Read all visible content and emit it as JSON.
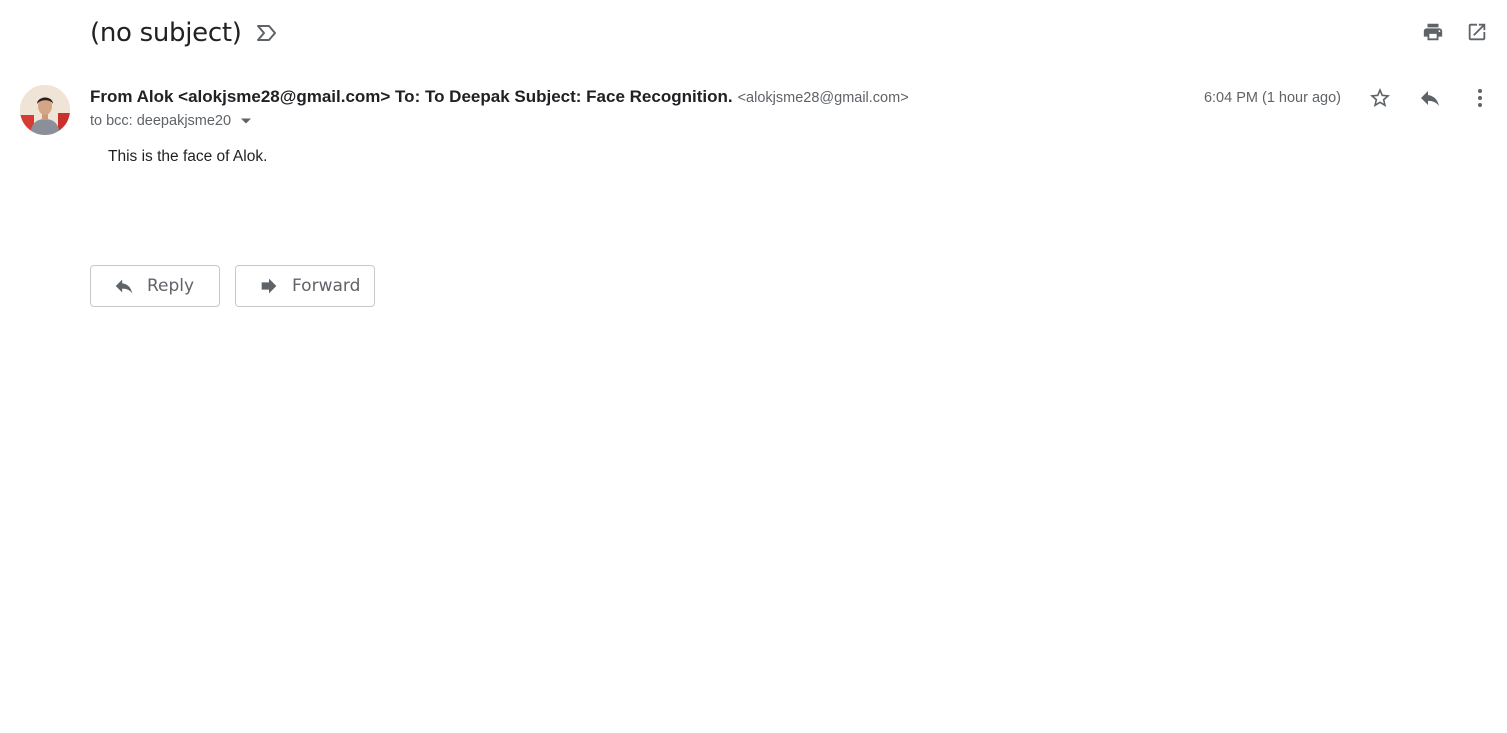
{
  "email": {
    "subject": "(no subject)",
    "sender_line": "From Alok <alokjsme28@gmail.com> To: To Deepak Subject: Face Recognition.",
    "sender_email": "<alokjsme28@gmail.com>",
    "recipients": "to bcc: deepakjsme20",
    "timestamp": "6:04 PM (1 hour ago)",
    "body": "This is the face of Alok."
  },
  "actions": {
    "reply_label": "Reply",
    "forward_label": "Forward"
  },
  "icons": {
    "label": "label-icon",
    "print": "print-icon",
    "open_new_window": "open-in-new-window-icon",
    "star": "star-icon",
    "reply": "reply-icon",
    "more": "more-vert-icon",
    "caret": "caret-down-icon",
    "forward": "forward-icon"
  },
  "colors": {
    "text_primary": "#202124",
    "text_secondary": "#5f6368",
    "button_border": "#c8c8c8"
  }
}
